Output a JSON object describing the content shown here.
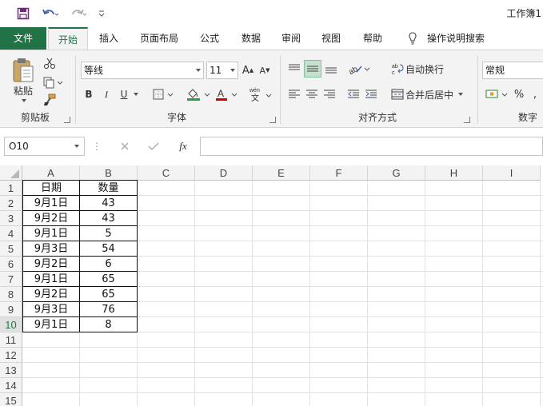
{
  "window": {
    "title": "工作簿1"
  },
  "tabs": [
    {
      "label": "文件"
    },
    {
      "label": "开始"
    },
    {
      "label": "插入"
    },
    {
      "label": "页面布局"
    },
    {
      "label": "公式"
    },
    {
      "label": "数据"
    },
    {
      "label": "审阅"
    },
    {
      "label": "视图"
    },
    {
      "label": "帮助"
    },
    {
      "label": "操作说明搜索"
    }
  ],
  "ribbon": {
    "clipboard": {
      "paste_label": "粘贴",
      "group_label": "剪贴板"
    },
    "font": {
      "font_name": "等线",
      "font_size": "11",
      "bold": "B",
      "italic": "I",
      "underline": "U",
      "group_label": "字体"
    },
    "alignment": {
      "wrap_text": "自动换行",
      "merge_center": "合并后居中",
      "group_label": "对齐方式"
    },
    "number": {
      "format": "常规",
      "percent": "%",
      "group_label": "数字"
    }
  },
  "formula_bar": {
    "name_box": "O10",
    "fx": "fx",
    "formula": ""
  },
  "columns": [
    "A",
    "B",
    "C",
    "D",
    "E",
    "F",
    "G",
    "H",
    "I"
  ],
  "rows": [
    "1",
    "2",
    "3",
    "4",
    "5",
    "6",
    "7",
    "8",
    "9",
    "10",
    "11",
    "12",
    "13",
    "14",
    "15"
  ],
  "table": {
    "headers": [
      "日期",
      "数量"
    ],
    "data": [
      [
        "9月1日",
        "43"
      ],
      [
        "9月2日",
        "43"
      ],
      [
        "9月1日",
        "5"
      ],
      [
        "9月3日",
        "54"
      ],
      [
        "9月2日",
        "6"
      ],
      [
        "9月1日",
        "65"
      ],
      [
        "9月2日",
        "65"
      ],
      [
        "9月3日",
        "76"
      ],
      [
        "9月1日",
        "8"
      ]
    ]
  },
  "colors": {
    "accent": "#217346",
    "grid": "#e1e1e1",
    "header_bg": "#f3f3f3"
  }
}
